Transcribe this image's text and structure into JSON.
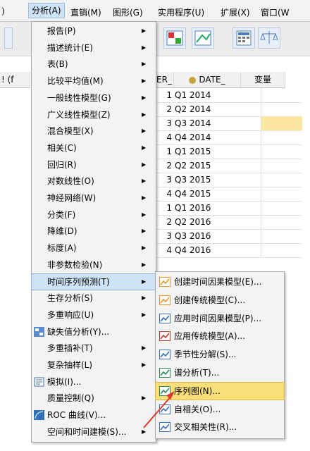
{
  "menubar": {
    "items": [
      ")",
      "分析(A)",
      "直销(M)",
      "图形(G)",
      "实用程序(U)",
      "扩展(X)",
      "窗口(W"
    ]
  },
  "grid": {
    "headers": {
      "partial_left": "! (f",
      "partial_mid": "ER_",
      "date": "DATE_",
      "var": "变量"
    },
    "rows": [
      {
        "n": "1",
        "date": "Q1 2014"
      },
      {
        "n": "2",
        "date": "Q2 2014"
      },
      {
        "n": "3",
        "date": "Q3 2014"
      },
      {
        "n": "4",
        "date": "Q4 2014"
      },
      {
        "n": "1",
        "date": "Q1 2015"
      },
      {
        "n": "2",
        "date": "Q2 2015"
      },
      {
        "n": "3",
        "date": "Q3 2015"
      },
      {
        "n": "4",
        "date": "Q4 2015"
      },
      {
        "n": "1",
        "date": "Q1 2016"
      },
      {
        "n": "2",
        "date": "Q2 2016"
      },
      {
        "n": "3",
        "date": "Q3 2016"
      },
      {
        "n": "4",
        "date": "Q4 2016"
      }
    ]
  },
  "analyze_menu": {
    "items": [
      {
        "label": "报告(P)",
        "sub": true
      },
      {
        "label": "描述统计(E)",
        "sub": true
      },
      {
        "label": "表(B)",
        "sub": true
      },
      {
        "label": "比较平均值(M)",
        "sub": true
      },
      {
        "label": "一般线性模型(G)",
        "sub": true
      },
      {
        "label": "广义线性模型(Z)",
        "sub": true
      },
      {
        "label": "混合模型(X)",
        "sub": true
      },
      {
        "label": "相关(C)",
        "sub": true
      },
      {
        "label": "回归(R)",
        "sub": true
      },
      {
        "label": "对数线性(O)",
        "sub": true
      },
      {
        "label": "神经网络(W)",
        "sub": true
      },
      {
        "label": "分类(F)",
        "sub": true
      },
      {
        "label": "降维(D)",
        "sub": true
      },
      {
        "label": "标度(A)",
        "sub": true
      },
      {
        "label": "非参数检验(N)",
        "sub": true
      },
      {
        "label": "时间序列预测(T)",
        "sub": true,
        "highlight": true
      },
      {
        "label": "生存分析(S)",
        "sub": true
      },
      {
        "label": "多重响应(U)",
        "sub": true
      },
      {
        "label": "缺失值分析(Y)...",
        "icon": "missing-value-icon"
      },
      {
        "label": "多重插补(T)",
        "sub": true
      },
      {
        "label": "复杂抽样(L)",
        "sub": true
      },
      {
        "label": "模拟(I)...",
        "icon": "simulation-icon"
      },
      {
        "label": "质量控制(Q)",
        "sub": true
      },
      {
        "label": "ROC 曲线(V)...",
        "icon": "roc-curve-icon"
      },
      {
        "label": "空间和时间建模(S)...",
        "sub": true
      }
    ]
  },
  "timeseries_submenu": {
    "items": [
      {
        "label": "创建时间因果模型(E)...",
        "icon": "temporal-causal-icon"
      },
      {
        "label": "创建传统模型(C)...",
        "icon": "traditional-model-icon"
      },
      {
        "label": "应用时间因果模型(P)...",
        "icon": "apply-temporal-causal-icon"
      },
      {
        "label": "应用传统模型(A)...",
        "icon": "apply-traditional-icon"
      },
      {
        "label": "季节性分解(S)...",
        "icon": "seasonal-decompose-icon"
      },
      {
        "label": "谱分析(T)...",
        "icon": "spectral-icon"
      },
      {
        "label": "序列图(N)...",
        "icon": "sequence-chart-icon",
        "highlight": true
      },
      {
        "label": "自相关(O)...",
        "icon": "autocorrelation-icon"
      },
      {
        "label": "交叉相关性(R)...",
        "icon": "cross-correlation-icon"
      }
    ]
  },
  "colors": {
    "highlight": "#cfe3f7",
    "sub_highlight": "#f8df7a",
    "cell_highlight": "#fbe7a1",
    "arrow": "#e0382c"
  }
}
